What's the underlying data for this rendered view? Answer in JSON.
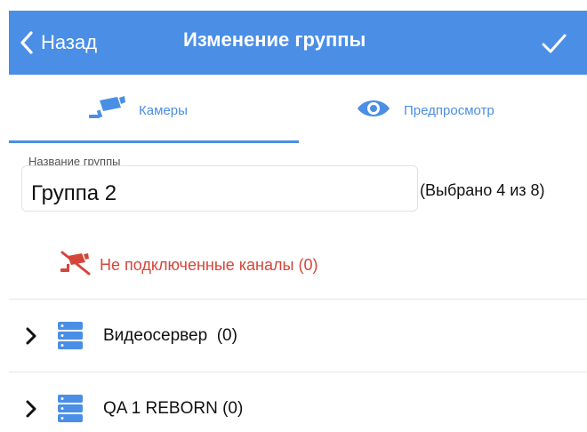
{
  "navbar": {
    "back_label": "Назад",
    "title": "Изменение группы"
  },
  "tabs": [
    {
      "label": "Камеры",
      "icon": "camera-icon",
      "active": true
    },
    {
      "label": "Предпросмотр",
      "icon": "eye-icon",
      "active": false
    }
  ],
  "group_form": {
    "caption": "Название группы",
    "value": "Группа 2",
    "selected_text": "(Выбрано 4 из 8)"
  },
  "disconnected": {
    "label": "Не подключенные каналы (0)",
    "icon": "camera-off-icon"
  },
  "servers": [
    {
      "label": "Видеосервер  (0)",
      "icon": "server-icon"
    },
    {
      "label": "QA 1 REBORN (0)",
      "icon": "server-icon"
    }
  ],
  "colors": {
    "accent": "#4a8ee6",
    "danger": "#d4463a"
  }
}
